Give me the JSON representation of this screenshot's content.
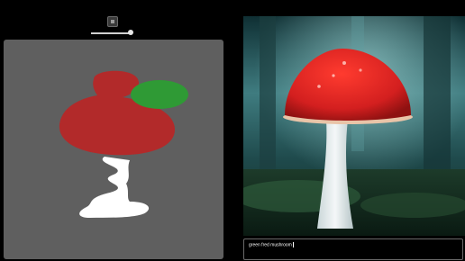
{
  "toolbar": {
    "icon": "canvas-tool-icon",
    "brush_size_level": 0.95
  },
  "sketch": {
    "background_color": "#5f5f5f",
    "strokes": [
      {
        "shape": "mushroom-cap",
        "color": "#b22a2a"
      },
      {
        "shape": "spot",
        "color": "#2f9a35"
      },
      {
        "shape": "stem",
        "color": "#ffffff"
      }
    ]
  },
  "result": {
    "subject": "red mushroom with white stem",
    "cap_color": "#d31f1f",
    "stem_color": "#e6eef0",
    "background_color": "#1f4a4c"
  },
  "prompt": {
    "value": "green fred mushroom"
  }
}
